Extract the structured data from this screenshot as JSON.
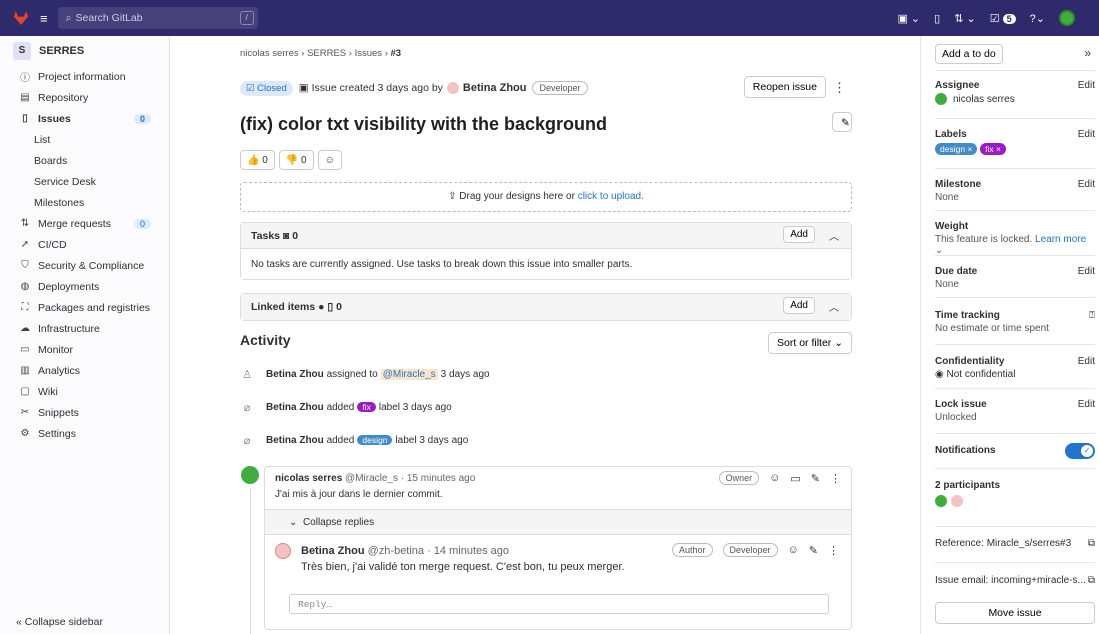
{
  "topbar": {
    "search_placeholder": "Search GitLab",
    "search_key": "/",
    "todo_count": "5"
  },
  "sidebar": {
    "project_initial": "S",
    "project_name": "SERRES",
    "items": [
      {
        "label": "Project information",
        "icon": "info-icon"
      },
      {
        "label": "Repository",
        "icon": "document-icon"
      },
      {
        "label": "Issues",
        "icon": "issues-icon",
        "count": "0"
      },
      {
        "label": "List"
      },
      {
        "label": "Boards"
      },
      {
        "label": "Service Desk"
      },
      {
        "label": "Milestones"
      },
      {
        "label": "Merge requests",
        "icon": "merge-request-icon",
        "count": "0"
      },
      {
        "label": "CI/CD",
        "icon": "rocket-icon"
      },
      {
        "label": "Security & Compliance",
        "icon": "shield-icon"
      },
      {
        "label": "Deployments",
        "icon": "deployments-icon"
      },
      {
        "label": "Packages and registries",
        "icon": "package-icon"
      },
      {
        "label": "Infrastructure",
        "icon": "cloud-icon"
      },
      {
        "label": "Monitor",
        "icon": "monitor-icon"
      },
      {
        "label": "Analytics",
        "icon": "chart-icon"
      },
      {
        "label": "Wiki",
        "icon": "book-icon"
      },
      {
        "label": "Snippets",
        "icon": "scissors-icon"
      },
      {
        "label": "Settings",
        "icon": "settings-icon"
      }
    ],
    "collapse_label": "Collapse sidebar"
  },
  "breadcrumb": {
    "user": "nicolas serres",
    "project": "SERRES",
    "section": "Issues",
    "issue": "#3"
  },
  "issue": {
    "status": "Closed",
    "created_text": "Issue created 3 days ago by",
    "author": "Betina Zhou",
    "author_role": "Developer",
    "reopen_label": "Reopen issue",
    "title": "(fix) color txt visibility with the background",
    "thumbs_up": "0",
    "thumbs_down": "0",
    "drop_text": "Drag your designs here or",
    "drop_link": "click to upload."
  },
  "tasks": {
    "label": "Tasks",
    "count": "0",
    "add_label": "Add",
    "empty_text": "No tasks are currently assigned. Use tasks to break down this issue into smaller parts."
  },
  "linked": {
    "label": "Linked items",
    "count": "0",
    "add_label": "Add"
  },
  "activity": {
    "heading": "Activity",
    "sort_label": "Sort or filter",
    "events": [
      {
        "actor": "Betina Zhou",
        "text1": "assigned to",
        "mention": "@Miracle_s",
        "time": "3 days ago"
      },
      {
        "actor": "Betina Zhou",
        "text1": "added",
        "label": "fix",
        "text2": "label 3 days ago"
      },
      {
        "actor": "Betina Zhou",
        "text1": "added",
        "label": "design",
        "text2": "label 3 days ago"
      }
    ]
  },
  "note": {
    "author": "nicolas serres",
    "handle": "@Miracle_s · 15 minutes ago",
    "badge": "Owner",
    "body": "J'ai mis à jour dans le dernier commit.",
    "collapse_label": "Collapse replies",
    "reply_author": "Betina Zhou",
    "reply_handle": "@zh-betina · 14 minutes ago",
    "reply_badge1": "Author",
    "reply_badge2": "Developer",
    "reply_body": "Très bien, j'ai validé ton merge request. C'est bon, tu peux merger.",
    "reply_placeholder": "Reply…"
  },
  "right": {
    "todo_label": "Add a to do",
    "assignee_h": "Assignee",
    "assignee": "nicolas serres",
    "edit": "Edit",
    "labels_h": "Labels",
    "label1": "design",
    "label2": "fix",
    "milestone_h": "Milestone",
    "milestone": "None",
    "weight_h": "Weight",
    "weight": "This feature is locked.",
    "learn_more": "Learn more",
    "due_h": "Due date",
    "due": "None",
    "time_h": "Time tracking",
    "time": "No estimate or time spent",
    "conf_h": "Confidentiality",
    "conf": "Not confidential",
    "lock_h": "Lock issue",
    "lock": "Unlocked",
    "notif_h": "Notifications",
    "participants_h": "2 participants",
    "reference": "Reference: Miracle_s/serres#3",
    "email": "Issue email: incoming+miracle-s...",
    "move_label": "Move issue"
  },
  "colors": {
    "accent": "#1f75cb",
    "fix_label": "#9b19c9",
    "design_label": "#428bca",
    "topbar": "#2f2a6b"
  }
}
